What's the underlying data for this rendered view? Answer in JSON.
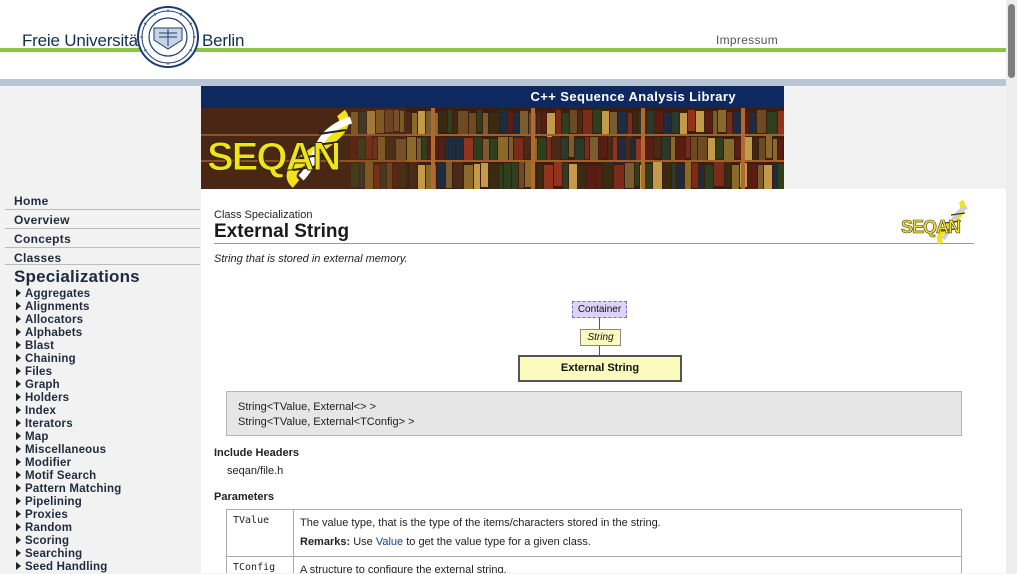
{
  "header": {
    "brand_left": "Freie Universität",
    "brand_right": "Berlin",
    "impressum": "Impressum"
  },
  "banner": {
    "title": "C++ Sequence Analysis Library",
    "logo_text": "SEQAN"
  },
  "sidebar": {
    "main_links": [
      {
        "label": "Home"
      },
      {
        "label": "Overview"
      },
      {
        "label": "Concepts"
      },
      {
        "label": "Classes"
      }
    ],
    "specializations_heading": "Specializations",
    "specializations": [
      "Aggregates",
      "Alignments",
      "Allocators",
      "Alphabets",
      "Blast",
      "Chaining",
      "Files",
      "Graph",
      "Holders",
      "Index",
      "Iterators",
      "Map",
      "Miscellaneous",
      "Modifier",
      "Motif Search",
      "Pattern Matching",
      "Pipelining",
      "Proxies",
      "Random",
      "Scoring",
      "Searching",
      "Seed Handling"
    ]
  },
  "content": {
    "kind": "Class Specialization",
    "title": "External String",
    "logo_text": "SEQAN",
    "description": "String that is stored in external memory.",
    "diagram": {
      "container": "Container",
      "string": "String",
      "external": "External String"
    },
    "signatures": [
      "String<TValue, External<> >",
      "String<TValue, External<TConfig> >"
    ],
    "include_heading": "Include Headers",
    "include_file": "seqan/file.h",
    "parameters_heading": "Parameters",
    "parameters": [
      {
        "name": "TValue",
        "desc": "The value type, that is the type of the items/characters stored in the string.",
        "remarks_label": "Remarks:",
        "remarks_pre": " Use ",
        "remarks_link": "Value",
        "remarks_post": " to get the value type for a given class."
      },
      {
        "name": "TConfig",
        "desc": "A structure to configure the external string."
      }
    ]
  },
  "colors": {
    "fu_green": "#8cc63e",
    "banner_navy": "#0e2860",
    "seqan_yellow": "#f2e21c"
  }
}
